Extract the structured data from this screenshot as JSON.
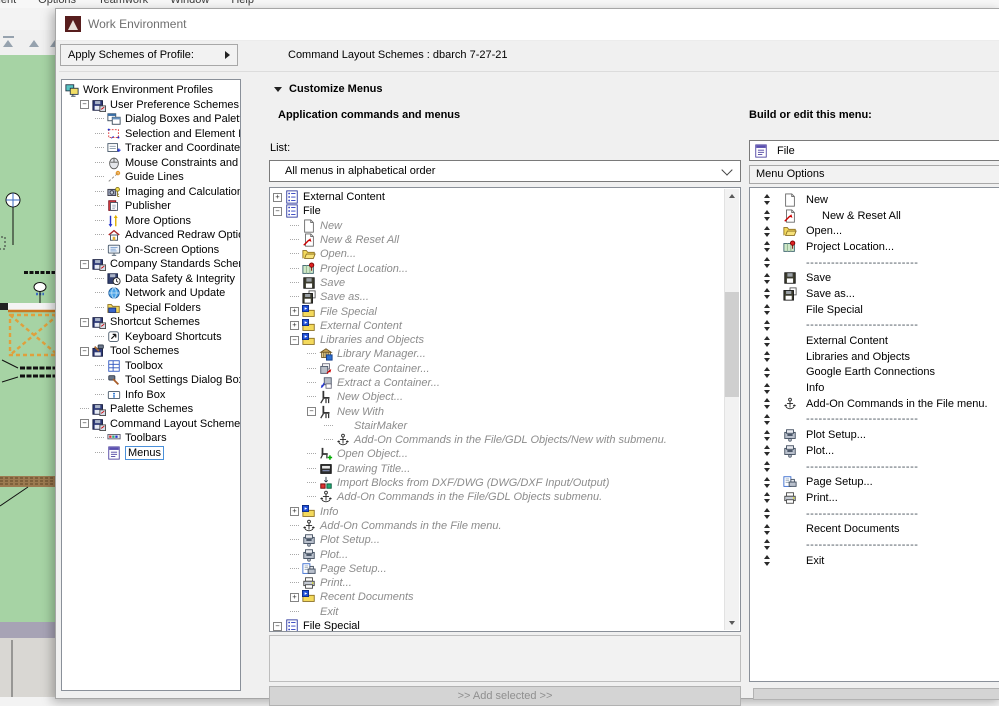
{
  "colors": {
    "canvas_green": "#a6d3a4",
    "accent_orange": "#e0a03c",
    "logo_maroon": "#571d1d",
    "selection_blue": "#4a90d9"
  },
  "menubar": {
    "items": [
      "Document",
      "Options",
      "Teamwork",
      "Window",
      "Help"
    ]
  },
  "dialog": {
    "title": "Work Environment",
    "apply_profile_button": "Apply Schemes of Profile:",
    "scheme_header": "Command Layout Schemes :  dbarch 7-27-21",
    "section_header": "Customize Menus",
    "left_tree": {
      "items": [
        {
          "lvl": 0,
          "icon": "profiles",
          "label": "Work Environment Profiles"
        },
        {
          "lvl": 1,
          "exp": "minus",
          "icon": "scheme",
          "label": "User Preference Schemes"
        },
        {
          "lvl": 2,
          "icon": "dialog-boxes",
          "label": "Dialog Boxes and Palettes"
        },
        {
          "lvl": 2,
          "icon": "selection",
          "label": "Selection and Element Information"
        },
        {
          "lvl": 2,
          "icon": "tracker",
          "label": "Tracker and Coordinate Input"
        },
        {
          "lvl": 2,
          "icon": "mouse",
          "label": "Mouse Constraints and Methods"
        },
        {
          "lvl": 2,
          "icon": "guide-lines",
          "label": "Guide Lines"
        },
        {
          "lvl": 2,
          "icon": "imaging",
          "label": "Imaging and Calculation"
        },
        {
          "lvl": 2,
          "icon": "publisher",
          "label": "Publisher"
        },
        {
          "lvl": 2,
          "icon": "more-options",
          "label": "More Options"
        },
        {
          "lvl": 2,
          "icon": "redraw",
          "label": "Advanced Redraw Options"
        },
        {
          "lvl": 2,
          "icon": "onscreen",
          "label": "On-Screen Options"
        },
        {
          "lvl": 1,
          "exp": "minus",
          "icon": "scheme",
          "label": "Company Standards Schemes"
        },
        {
          "lvl": 2,
          "icon": "data-safety",
          "label": "Data Safety & Integrity"
        },
        {
          "lvl": 2,
          "icon": "network",
          "label": "Network and Update"
        },
        {
          "lvl": 2,
          "icon": "special-folders",
          "label": "Special Folders"
        },
        {
          "lvl": 1,
          "exp": "minus",
          "icon": "scheme",
          "label": "Shortcut Schemes"
        },
        {
          "lvl": 2,
          "icon": "keyboard",
          "label": "Keyboard Shortcuts"
        },
        {
          "lvl": 1,
          "exp": "minus",
          "icon": "tool-scheme",
          "label": "Tool Schemes"
        },
        {
          "lvl": 2,
          "icon": "toolbox",
          "label": "Toolbox"
        },
        {
          "lvl": 2,
          "icon": "tool-settings",
          "label": "Tool Settings Dialog Boxes"
        },
        {
          "lvl": 2,
          "icon": "info-box",
          "label": "Info Box"
        },
        {
          "lvl": 1,
          "icon": "scheme",
          "label": "Palette Schemes"
        },
        {
          "lvl": 1,
          "exp": "minus",
          "icon": "scheme",
          "label": "Command Layout Schemes"
        },
        {
          "lvl": 2,
          "icon": "toolbars",
          "label": "Toolbars"
        },
        {
          "lvl": 2,
          "icon": "menus",
          "label": "Menus",
          "selected": true
        }
      ]
    },
    "middle": {
      "heading": "Application commands and menus",
      "list_label": "List:",
      "list_dropdown_value": "All menus in alphabetical order",
      "add_selected_button": ">> Add selected >>",
      "tree": [
        {
          "lvl": 0,
          "exp": "plus",
          "icon": "menu",
          "label": "External Content"
        },
        {
          "lvl": 0,
          "exp": "minus",
          "icon": "menu",
          "label": "File"
        },
        {
          "lvl": 1,
          "icon": "page",
          "label": "New",
          "dim": true
        },
        {
          "lvl": 1,
          "icon": "new-reset",
          "label": "New & Reset All",
          "dim": true
        },
        {
          "lvl": 1,
          "icon": "open-folder",
          "label": "Open...",
          "dim": true
        },
        {
          "lvl": 1,
          "icon": "map-pin",
          "label": "Project Location...",
          "dim": true
        },
        {
          "lvl": 1,
          "icon": "floppy",
          "label": "Save",
          "dim": true
        },
        {
          "lvl": 1,
          "icon": "floppy-as",
          "label": "Save as...",
          "dim": true
        },
        {
          "lvl": 1,
          "exp": "plus",
          "icon": "folder-sub",
          "label": "File Special",
          "dim": true
        },
        {
          "lvl": 1,
          "exp": "plus",
          "icon": "folder-sub",
          "label": "External Content",
          "dim": true
        },
        {
          "lvl": 1,
          "exp": "minus",
          "icon": "folder-sub",
          "label": "Libraries and Objects",
          "dim": true
        },
        {
          "lvl": 2,
          "icon": "library",
          "label": "Library Manager...",
          "dim": true
        },
        {
          "lvl": 2,
          "icon": "container-new",
          "label": "Create Container...",
          "dim": true
        },
        {
          "lvl": 2,
          "icon": "container-extract",
          "label": "Extract a Container...",
          "dim": true
        },
        {
          "lvl": 2,
          "icon": "object",
          "label": "New Object...",
          "dim": true
        },
        {
          "lvl": 2,
          "exp": "minus",
          "icon": "object",
          "label": "New With",
          "dim": true
        },
        {
          "lvl": 3,
          "icon": "none",
          "label": "StairMaker",
          "dim": true
        },
        {
          "lvl": 3,
          "icon": "anchor",
          "label": "Add-On Commands in the File/GDL Objects/New with submenu.",
          "dim": true
        },
        {
          "lvl": 2,
          "icon": "object-open",
          "label": "Open Object...",
          "dim": true
        },
        {
          "lvl": 2,
          "icon": "drawing-title",
          "label": "Drawing Title...",
          "dim": true
        },
        {
          "lvl": 2,
          "icon": "import-blocks",
          "label": "Import Blocks from DXF/DWG (DWG/DXF Input/Output)",
          "dim": true
        },
        {
          "lvl": 2,
          "icon": "anchor",
          "label": "Add-On Commands in the File/GDL Objects submenu.",
          "dim": true
        },
        {
          "lvl": 1,
          "exp": "plus",
          "icon": "folder-sub",
          "label": "Info",
          "dim": true
        },
        {
          "lvl": 1,
          "icon": "anchor",
          "label": "Add-On Commands in the File menu.",
          "dim": true
        },
        {
          "lvl": 1,
          "icon": "plotter",
          "label": "Plot Setup...",
          "dim": true
        },
        {
          "lvl": 1,
          "icon": "plotter",
          "label": "Plot...",
          "dim": true
        },
        {
          "lvl": 1,
          "icon": "page-setup",
          "label": "Page Setup...",
          "dim": true
        },
        {
          "lvl": 1,
          "icon": "printer",
          "label": "Print...",
          "dim": true
        },
        {
          "lvl": 1,
          "exp": "plus",
          "icon": "folder-sub",
          "label": "Recent Documents",
          "dim": true
        },
        {
          "lvl": 1,
          "icon": "none",
          "label": "Exit",
          "dim": true
        },
        {
          "lvl": 0,
          "exp": "minus",
          "icon": "menu",
          "label": "File Special"
        }
      ]
    },
    "right": {
      "heading": "Build or edit this menu:",
      "menu_field_value": "File",
      "menu_options_button": "Menu Options",
      "separator_text": "---------------------------",
      "rows": [
        {
          "icon": "page",
          "label": "New"
        },
        {
          "icon": "new-reset",
          "label": "New & Reset All",
          "indent": 1
        },
        {
          "icon": "open-folder",
          "label": "Open..."
        },
        {
          "icon": "map-pin",
          "label": "Project Location..."
        },
        {
          "separator": true
        },
        {
          "icon": "floppy",
          "label": "Save"
        },
        {
          "icon": "floppy-as",
          "label": "Save as..."
        },
        {
          "icon": "none",
          "label": "File Special"
        },
        {
          "separator": true
        },
        {
          "icon": "none",
          "label": "External Content"
        },
        {
          "icon": "none",
          "label": "Libraries and Objects"
        },
        {
          "icon": "none",
          "label": "Google Earth Connections"
        },
        {
          "icon": "none",
          "label": "Info"
        },
        {
          "icon": "anchor",
          "label": "Add-On Commands in the File menu."
        },
        {
          "separator": true
        },
        {
          "icon": "plotter",
          "label": "Plot Setup..."
        },
        {
          "icon": "plotter",
          "label": "Plot..."
        },
        {
          "separator": true
        },
        {
          "icon": "page-setup",
          "label": "Page Setup..."
        },
        {
          "icon": "printer",
          "label": "Print..."
        },
        {
          "separator": true
        },
        {
          "icon": "none",
          "label": "Recent Documents"
        },
        {
          "separator": true
        },
        {
          "icon": "none",
          "label": "Exit"
        }
      ]
    }
  }
}
